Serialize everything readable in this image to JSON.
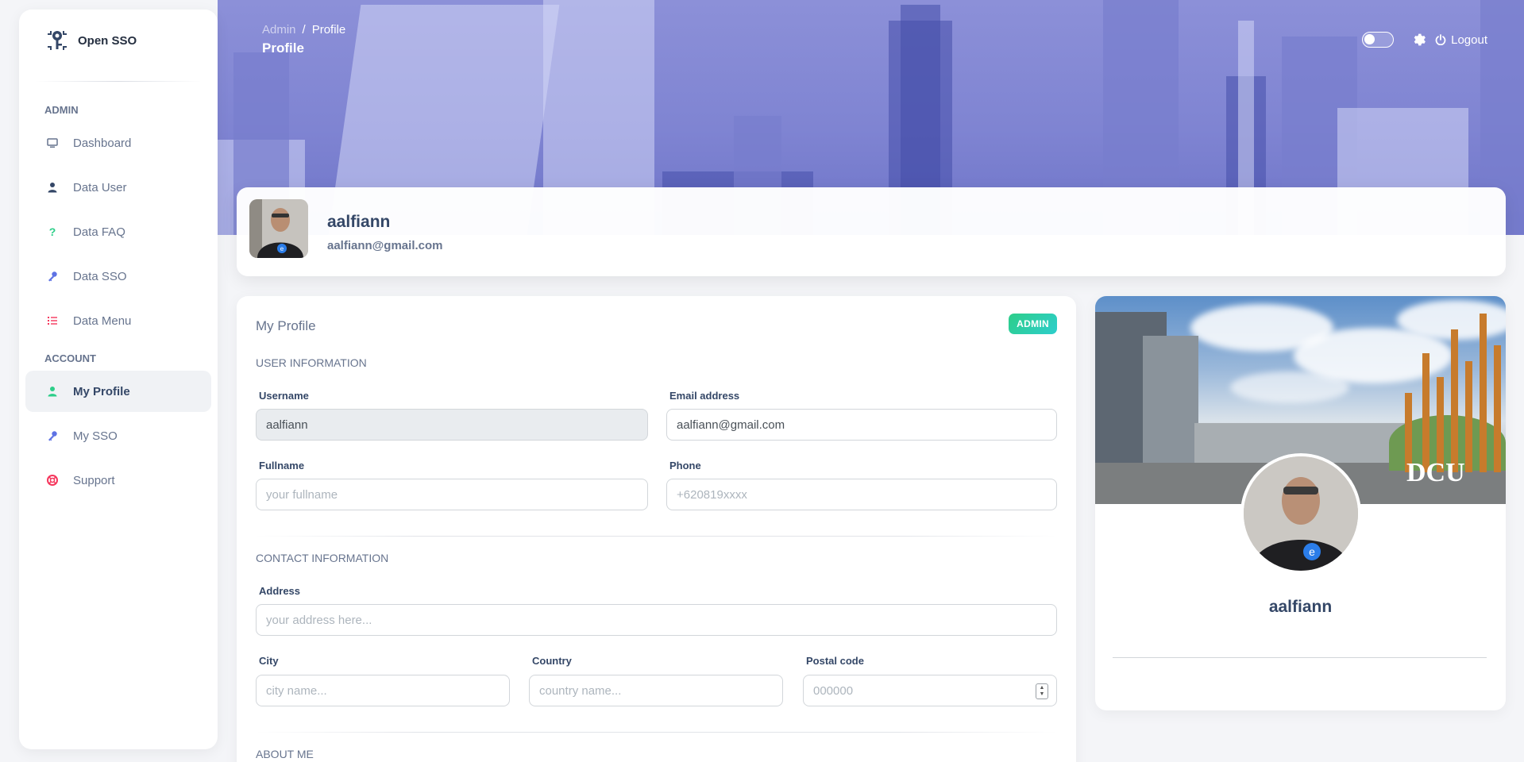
{
  "brand": {
    "name": "Open SSO"
  },
  "sidebar": {
    "sections": [
      {
        "title": "ADMIN",
        "items": [
          {
            "label": "Dashboard",
            "icon": "monitor-icon"
          },
          {
            "label": "Data User",
            "icon": "user-icon"
          },
          {
            "label": "Data FAQ",
            "icon": "question-icon"
          },
          {
            "label": "Data SSO",
            "icon": "key-icon"
          },
          {
            "label": "Data Menu",
            "icon": "list-icon"
          }
        ]
      },
      {
        "title": "ACCOUNT",
        "items": [
          {
            "label": "My Profile",
            "icon": "user-icon",
            "active": true
          },
          {
            "label": "My SSO",
            "icon": "key-icon"
          },
          {
            "label": "Support",
            "icon": "lifebuoy-icon"
          }
        ]
      }
    ]
  },
  "header": {
    "breadcrumb": {
      "root": "Admin",
      "separator": "/",
      "current": "Profile"
    },
    "title": "Profile",
    "logout_label": "Logout"
  },
  "profile": {
    "name": "aalfiann",
    "email": "aalfiann@gmail.com"
  },
  "form": {
    "title": "My Profile",
    "role_badge": "ADMIN",
    "user_section": "USER INFORMATION",
    "username": {
      "label": "Username",
      "value": "aalfiann"
    },
    "email": {
      "label": "Email address",
      "value": "aalfiann@gmail.com"
    },
    "fullname": {
      "label": "Fullname",
      "placeholder": "your fullname"
    },
    "phone": {
      "label": "Phone",
      "placeholder": "+620819xxxx"
    },
    "contact_section": "CONTACT INFORMATION",
    "address": {
      "label": "Address",
      "placeholder": "your address here..."
    },
    "city": {
      "label": "City",
      "placeholder": "city name..."
    },
    "country": {
      "label": "Country",
      "placeholder": "country name..."
    },
    "postal": {
      "label": "Postal code",
      "placeholder": "000000"
    },
    "about_section": "ABOUT ME"
  },
  "side_card": {
    "name": "aalfiann",
    "cover_text": "DCU"
  },
  "colors": {
    "accent": "#344767",
    "badge": "#2dce89",
    "banner": "#8c90d8",
    "icon_dashboard": "#67748e",
    "icon_user": "#344767",
    "icon_faq": "#2dce89",
    "icon_sso": "#5e72e4",
    "icon_menu": "#f5365c",
    "icon_profile": "#2dce89",
    "icon_support": "#f5365c"
  }
}
